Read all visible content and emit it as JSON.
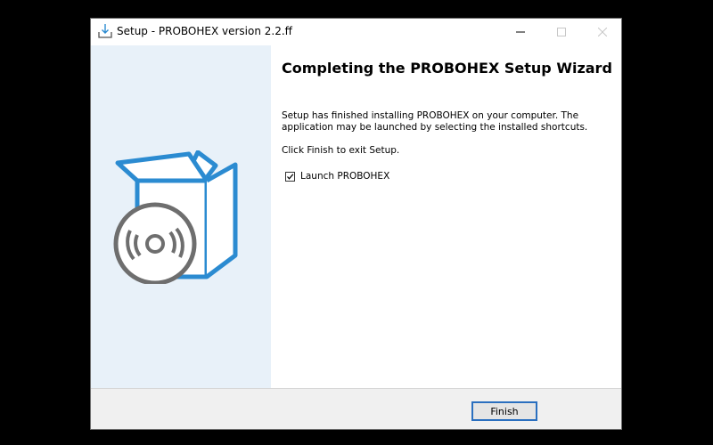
{
  "window": {
    "title": "Setup - PROBOHEX version 2.2.ff",
    "controls": [
      "minimize-icon",
      "maximize-icon",
      "close-icon"
    ]
  },
  "wizard": {
    "heading": "Completing the PROBOHEX Setup Wizard",
    "body_text": "Setup has finished installing PROBOHEX on your computer. The application may be launched by selecting the installed shortcuts.",
    "exit_text": "Click Finish to exit Setup.",
    "launch_checkbox": {
      "label": "Launch PROBOHEX",
      "checked": true
    }
  },
  "footer": {
    "finish_label": "Finish"
  },
  "colors": {
    "side_panel": "#e8f1f9",
    "accent_blue": "#2b8bd1",
    "disc_gray": "#6e6e6e",
    "button_border": "#2a6fbf"
  }
}
